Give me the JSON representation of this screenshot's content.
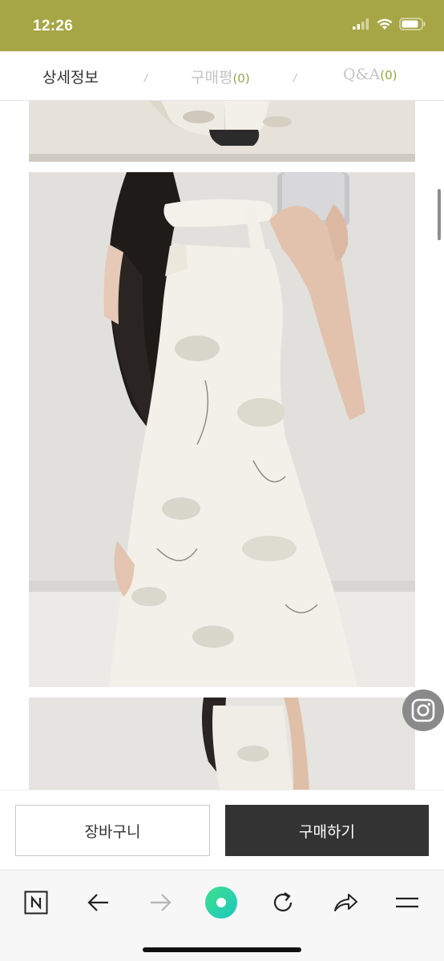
{
  "status_bar": {
    "time": "12:26",
    "icons": [
      "signal-icon",
      "wifi-icon",
      "battery-icon"
    ]
  },
  "tabs": [
    {
      "label": "상세정보",
      "count": ""
    },
    {
      "label": "구매평",
      "count": "(0)"
    },
    {
      "label": "Q&A",
      "count": "(0)"
    }
  ],
  "tab_separator": "/",
  "images": [
    {
      "name": "product-photo-top"
    },
    {
      "name": "product-photo-main"
    },
    {
      "name": "product-photo-bottom"
    }
  ],
  "floating": {
    "icon": "instagram-icon"
  },
  "actions": {
    "cart_label": "장바구니",
    "buy_label": "구매하기"
  },
  "browser_nav": [
    "naver-home-icon",
    "back-arrow-icon",
    "forward-arrow-icon",
    "green-dot-icon",
    "reload-icon",
    "share-icon",
    "menu-icon"
  ],
  "colors": {
    "status_bar": "#a6a646",
    "count_accent": "#9aa34b",
    "buy_button": "#333333",
    "nav_green": "#2ed0a0"
  }
}
